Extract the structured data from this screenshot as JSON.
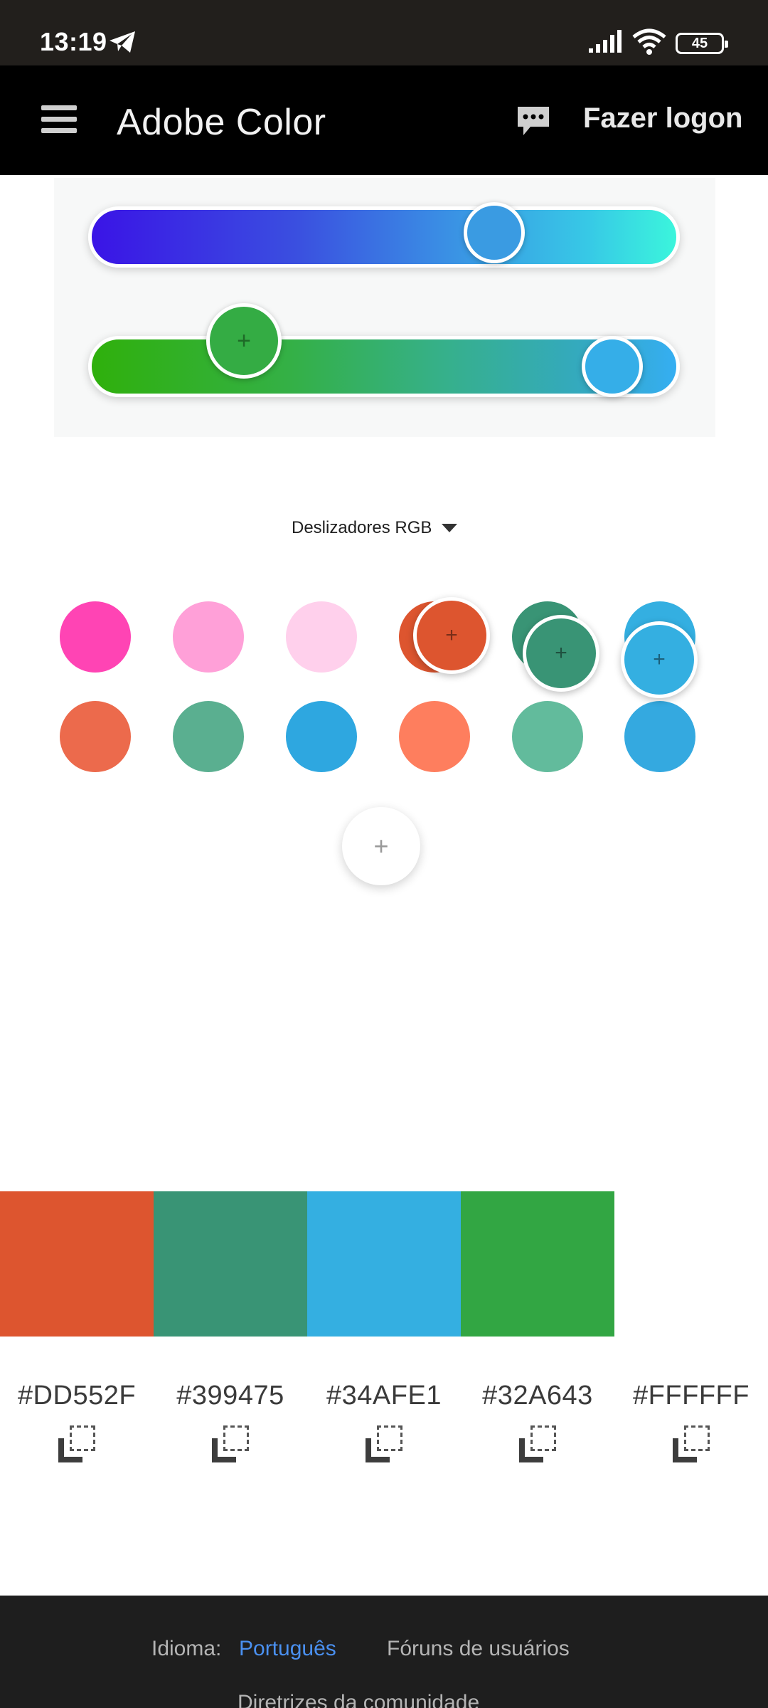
{
  "status_bar": {
    "time": "13:19",
    "battery": "45",
    "icons": [
      "telegram-icon",
      "signal-icon",
      "wifi-icon",
      "battery-icon"
    ]
  },
  "header": {
    "title": "Adobe Color",
    "login_label": "Fazer logon",
    "icons": [
      "menu-icon",
      "chat-icon"
    ]
  },
  "sliders": {
    "mode_label": "Deslizadores RGB",
    "track_1_gradient": [
      "#3a14e6",
      "#3bf5dc"
    ],
    "track_2_gradient": [
      "#2fb00c",
      "#35aef2"
    ],
    "knob_1_color": "#3a9be2",
    "knob_2_color": "#35aee8",
    "knob_3_color": "#34ac44"
  },
  "swatches": {
    "row_1": [
      "#ff44b4",
      "#ffa0d8",
      "#ffd0ec",
      "#dd552f",
      "#399475",
      "#34afe1"
    ],
    "row_2": [
      "#ec6a4c",
      "#5aaf90",
      "#2ea7e0",
      "#fe7e5e",
      "#62bb9c",
      "#34a9e0"
    ],
    "selected": [
      "#dd552f",
      "#399475",
      "#34afe1"
    ],
    "add_label": "+"
  },
  "palette": {
    "colors": [
      {
        "hex": "#DD552F",
        "color": "#dd552f"
      },
      {
        "hex": "#399475",
        "color": "#399475"
      },
      {
        "hex": "#34AFE1",
        "color": "#34afe1"
      },
      {
        "hex": "#32A643",
        "color": "#32a643"
      },
      {
        "hex": "#FFFFFF",
        "color": "#ffffff"
      }
    ]
  },
  "footer": {
    "language_label": "Idioma:",
    "language_value": "Português",
    "forums_label": "Fóruns de usuários",
    "guidelines_label": "Diretrizes da comunidade"
  }
}
